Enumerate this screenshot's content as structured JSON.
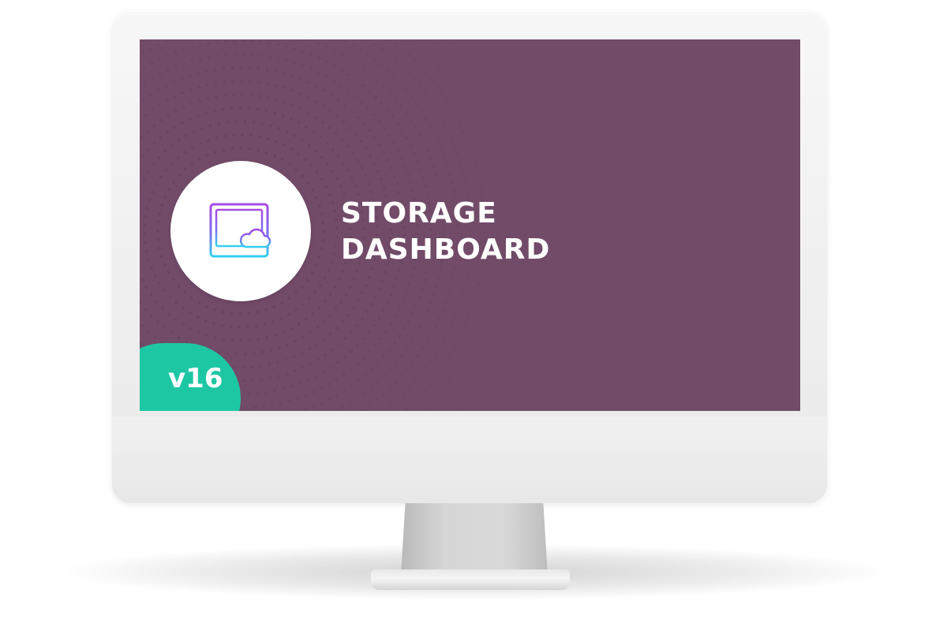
{
  "screen": {
    "title_line1": "STORAGE",
    "title_line2": "DASHBOARD",
    "version_badge": "v16",
    "background_color": "#724b69",
    "badge_color": "#1ec7a4"
  },
  "icons": {
    "app_icon": "dashboard-cloud-icon"
  }
}
